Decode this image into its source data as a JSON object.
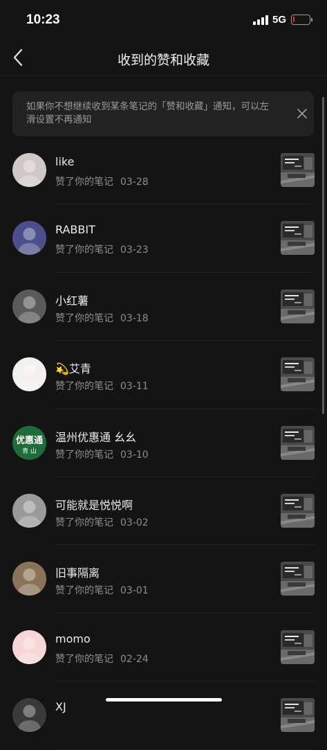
{
  "status_bar": {
    "time": "10:23",
    "network": "5G",
    "battery_level": 0.08,
    "battery_color": "#e5352d"
  },
  "nav": {
    "title": "收到的赞和收藏",
    "back_icon": "chevron-left-icon"
  },
  "tip": {
    "text": "如果你不想继续收到某条笔记的「赞和收藏」通知，可以左滑设置不再通知",
    "close_icon": "close-icon"
  },
  "notifications": [
    {
      "name": "like",
      "action": "赞了你的笔记",
      "date": "03-28",
      "avatar_bg": "#cfc8c4"
    },
    {
      "name": "RABBIT",
      "action": "赞了你的笔记",
      "date": "03-23",
      "avatar_bg": "#4d4f8c"
    },
    {
      "name": "小红薯",
      "action": "赞了你的笔记",
      "date": "03-18",
      "avatar_bg": "#5a5a5a"
    },
    {
      "name": "💫艾青",
      "action": "赞了你的笔记",
      "date": "03-11",
      "avatar_bg": "#f3f1ee"
    },
    {
      "name": "温州优惠通 幺幺",
      "action": "赞了你的笔记",
      "date": "03-10",
      "avatar_bg": "#1f6b3a",
      "avatar_text_top": "优惠通",
      "avatar_text_bottom": "青 山"
    },
    {
      "name": "可能就是悦悦啊",
      "action": "赞了你的笔记",
      "date": "03-02",
      "avatar_bg": "#9a9a9a"
    },
    {
      "name": "旧事隔离",
      "action": "赞了你的笔记",
      "date": "03-01",
      "avatar_bg": "#8a7358"
    },
    {
      "name": "momo",
      "action": "赞了你的笔记",
      "date": "02-24",
      "avatar_bg": "#f6d6d6"
    },
    {
      "name": "XJ",
      "action": "",
      "date": "",
      "avatar_bg": "#3a3a3a"
    }
  ]
}
